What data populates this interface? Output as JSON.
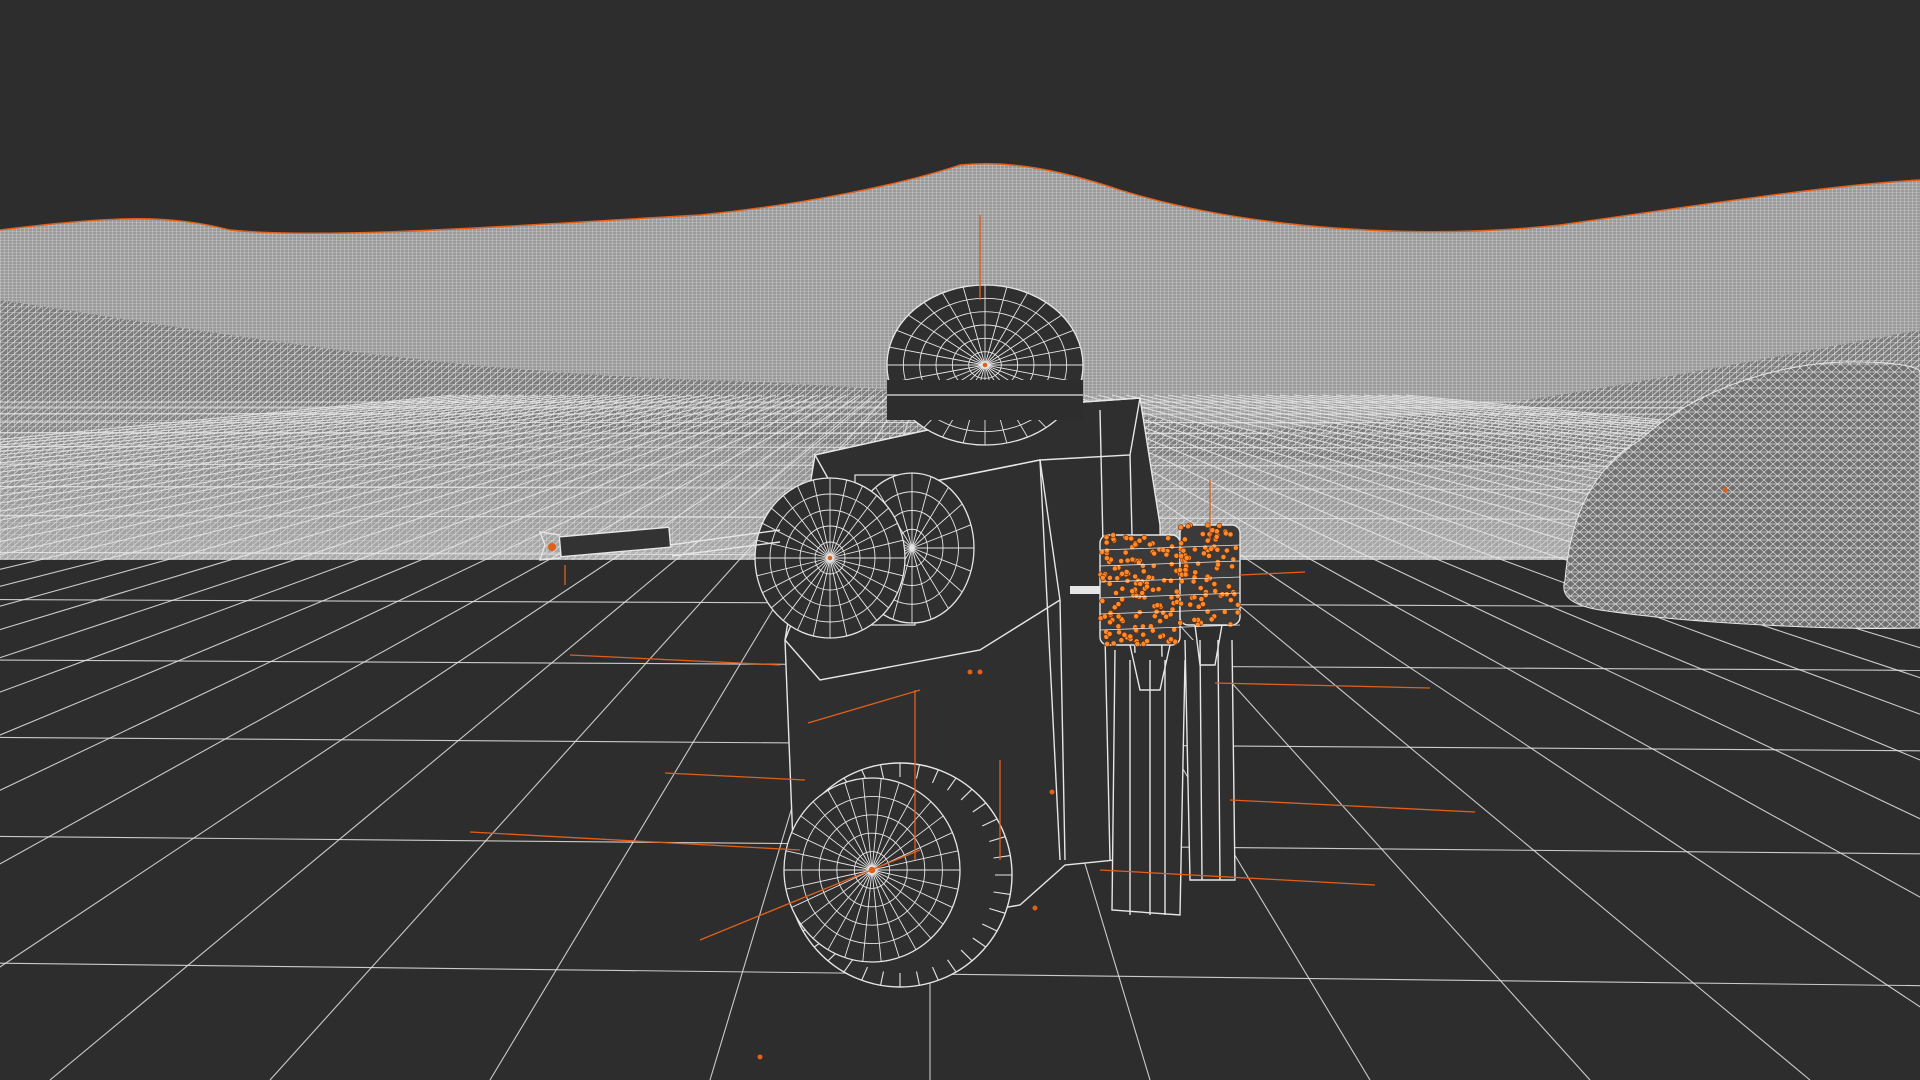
{
  "viewport": {
    "mode": "wireframe",
    "colors": {
      "background": "#2d2d2d",
      "wire": "#e6e6e6",
      "terrain_fill": "#8f8f8f",
      "selected": "#e0601a",
      "vertex": "#ff8a2a"
    }
  },
  "objects": [
    {
      "name": "terrain",
      "icon": "terrain-mesh-icon"
    },
    {
      "name": "ground-grid",
      "icon": "grid-icon"
    },
    {
      "name": "rock",
      "icon": "rock-mesh-icon"
    },
    {
      "name": "rover-body",
      "icon": "cube-icon"
    },
    {
      "name": "antenna-dish",
      "icon": "sphere-icon"
    },
    {
      "name": "side-drum",
      "icon": "cylinder-icon"
    },
    {
      "name": "robot-arm",
      "icon": "arm-icon"
    },
    {
      "name": "wheel",
      "icon": "wheel-icon"
    },
    {
      "name": "thruster-pods",
      "icon": "thruster-icon"
    }
  ]
}
